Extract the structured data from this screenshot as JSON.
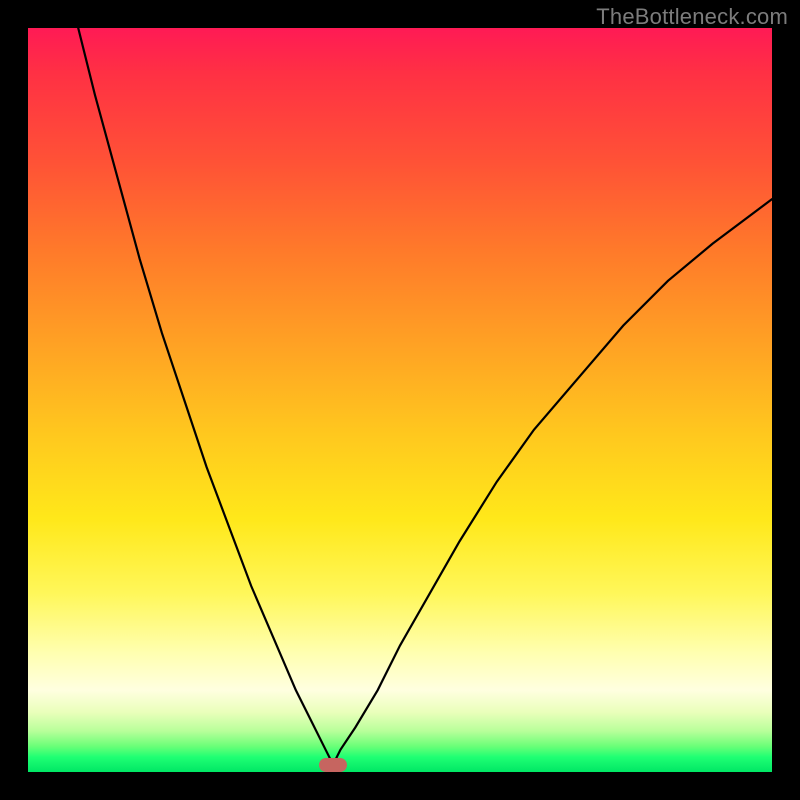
{
  "watermark": "TheBottleneck.com",
  "chart_data": {
    "type": "line",
    "title": "",
    "xlabel": "",
    "ylabel": "",
    "xlim": [
      0,
      100
    ],
    "ylim": [
      0,
      100
    ],
    "grid": false,
    "legend": false,
    "note": "V-shaped bottleneck curve over a vertical red→green gradient. x is an unlabeled horizontal axis (0–100), y is bottleneck severity (0 = optimal/green at bottom, 100 = worst/red at top). Minimum marked by a small rounded dot near x≈41.",
    "series": [
      {
        "name": "bottleneck-curve",
        "x": [
          0,
          3,
          6,
          9,
          12,
          15,
          18,
          21,
          24,
          27,
          30,
          33,
          36,
          38,
          40,
          41,
          42,
          44,
          47,
          50,
          54,
          58,
          63,
          68,
          74,
          80,
          86,
          92,
          100
        ],
        "y": [
          131,
          117,
          103,
          91,
          80,
          69,
          59,
          50,
          41,
          33,
          25,
          18,
          11,
          7,
          3,
          1,
          3,
          6,
          11,
          17,
          24,
          31,
          39,
          46,
          53,
          60,
          66,
          71,
          77
        ]
      }
    ],
    "marker": {
      "x": 41,
      "y": 1
    },
    "gradient_stops": [
      {
        "pos": 0,
        "color": "#ff1a55"
      },
      {
        "pos": 18,
        "color": "#ff5236"
      },
      {
        "pos": 42,
        "color": "#ffa024"
      },
      {
        "pos": 66,
        "color": "#ffe81a"
      },
      {
        "pos": 89,
        "color": "#ffffe0"
      },
      {
        "pos": 96,
        "color": "#6cff78"
      },
      {
        "pos": 100,
        "color": "#00e765"
      }
    ]
  }
}
